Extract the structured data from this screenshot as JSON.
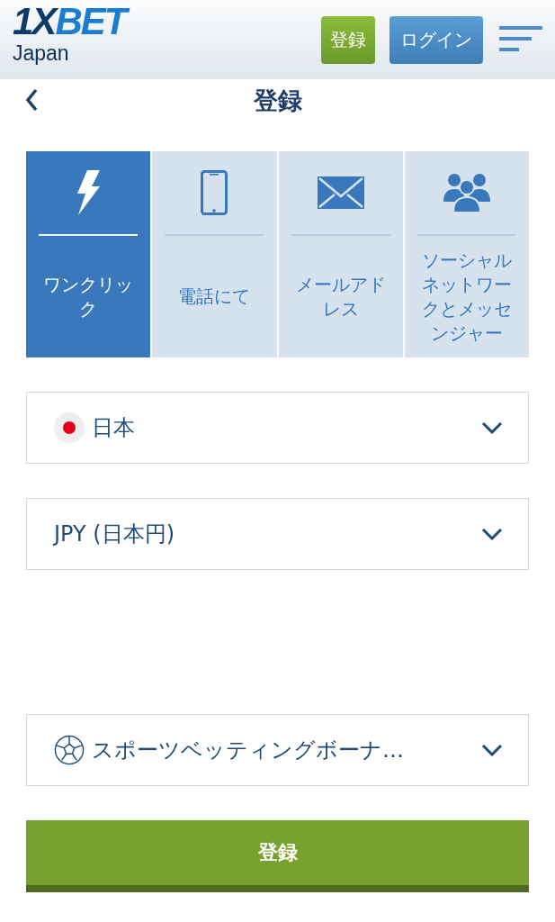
{
  "header": {
    "logo": {
      "part_1": "1X",
      "part_2": "BET"
    },
    "region": "Japan",
    "register_button": "登録",
    "login_button": "ログイン"
  },
  "page_title": "登録",
  "tabs": [
    {
      "label": "ワンクリック",
      "kind": "bolt",
      "selected": true
    },
    {
      "label": "電話にて",
      "kind": "phone",
      "selected": false
    },
    {
      "label": "メールアドレス",
      "kind": "mail",
      "selected": false
    },
    {
      "label": "ソーシャルネットワークとメッセンジャー",
      "kind": "people",
      "selected": false
    }
  ],
  "fields": [
    {
      "kind": "country",
      "value": "日本"
    },
    {
      "kind": "plain",
      "value": "JPY (日本円)"
    },
    {
      "kind": "hidden"
    },
    {
      "kind": "bonus",
      "value": "スポーツベッティングボーナ…"
    }
  ],
  "submit_button": "登録"
}
